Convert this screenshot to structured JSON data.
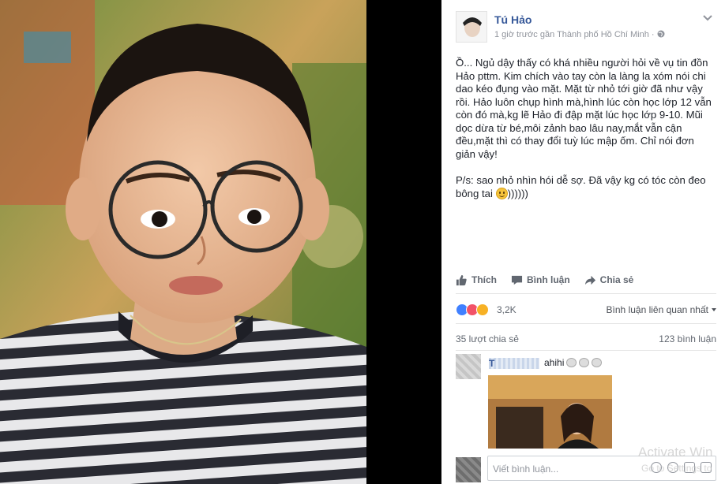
{
  "post": {
    "author": "Tú Hảo",
    "meta": "1 giờ trước gần Thành phố Hồ Chí Minh · ",
    "globe_icon": "globe-icon",
    "menu_icon": "chevron-down-icon",
    "paragraph1": "Ồ... Ngủ dậy thấy có khá nhiều người hỏi về vụ tin đồn Hảo pttm. Kim chích vào tay còn la làng la xóm nói chi dao kéo đụng vào mặt. Mặt từ nhỏ tới giờ đã như vậy rồi. Hảo luôn chụp hình mà,hình lúc còn học lớp 12 vẫn còn đó mà,kg lẽ Hảo đi đập mặt lúc học lớp 9-10. Mũi dọc dừa từ bé,môi zảnh bao lâu nay,mắt vẫn cận đều,mặt thì có thay đổi tuỳ lúc mập ốm. Chỉ nói đơn giản vậy!",
    "paragraph2_prefix": "P/s: sao nhỏ nhìn hói dễ sợ. Đã vậy kg có tóc còn đeo bông tai ",
    "paragraph2_suffix": "))))))",
    "emoji": "smile-emoji"
  },
  "actions": {
    "like": "Thích",
    "comment": "Bình luận",
    "share": "Chia sẻ"
  },
  "stats": {
    "reaction_count": "3,2K",
    "reactions": [
      "like",
      "love",
      "haha"
    ],
    "sort_label": "Bình luận liên quan nhất",
    "shares": "35 lượt chia sẻ",
    "comments": "123 bình luận"
  },
  "comment": {
    "name_prefix": "T",
    "text": "ahihi",
    "emoji_count": 3
  },
  "composer": {
    "placeholder": "Viết bình luận..."
  },
  "watermark": {
    "title": "Activate Win",
    "subtitle": "Go to Settings to"
  },
  "colors": {
    "link": "#365899",
    "meta": "#90949c",
    "like": "#4080ff",
    "love": "#f25268",
    "haha": "#f7b125"
  }
}
